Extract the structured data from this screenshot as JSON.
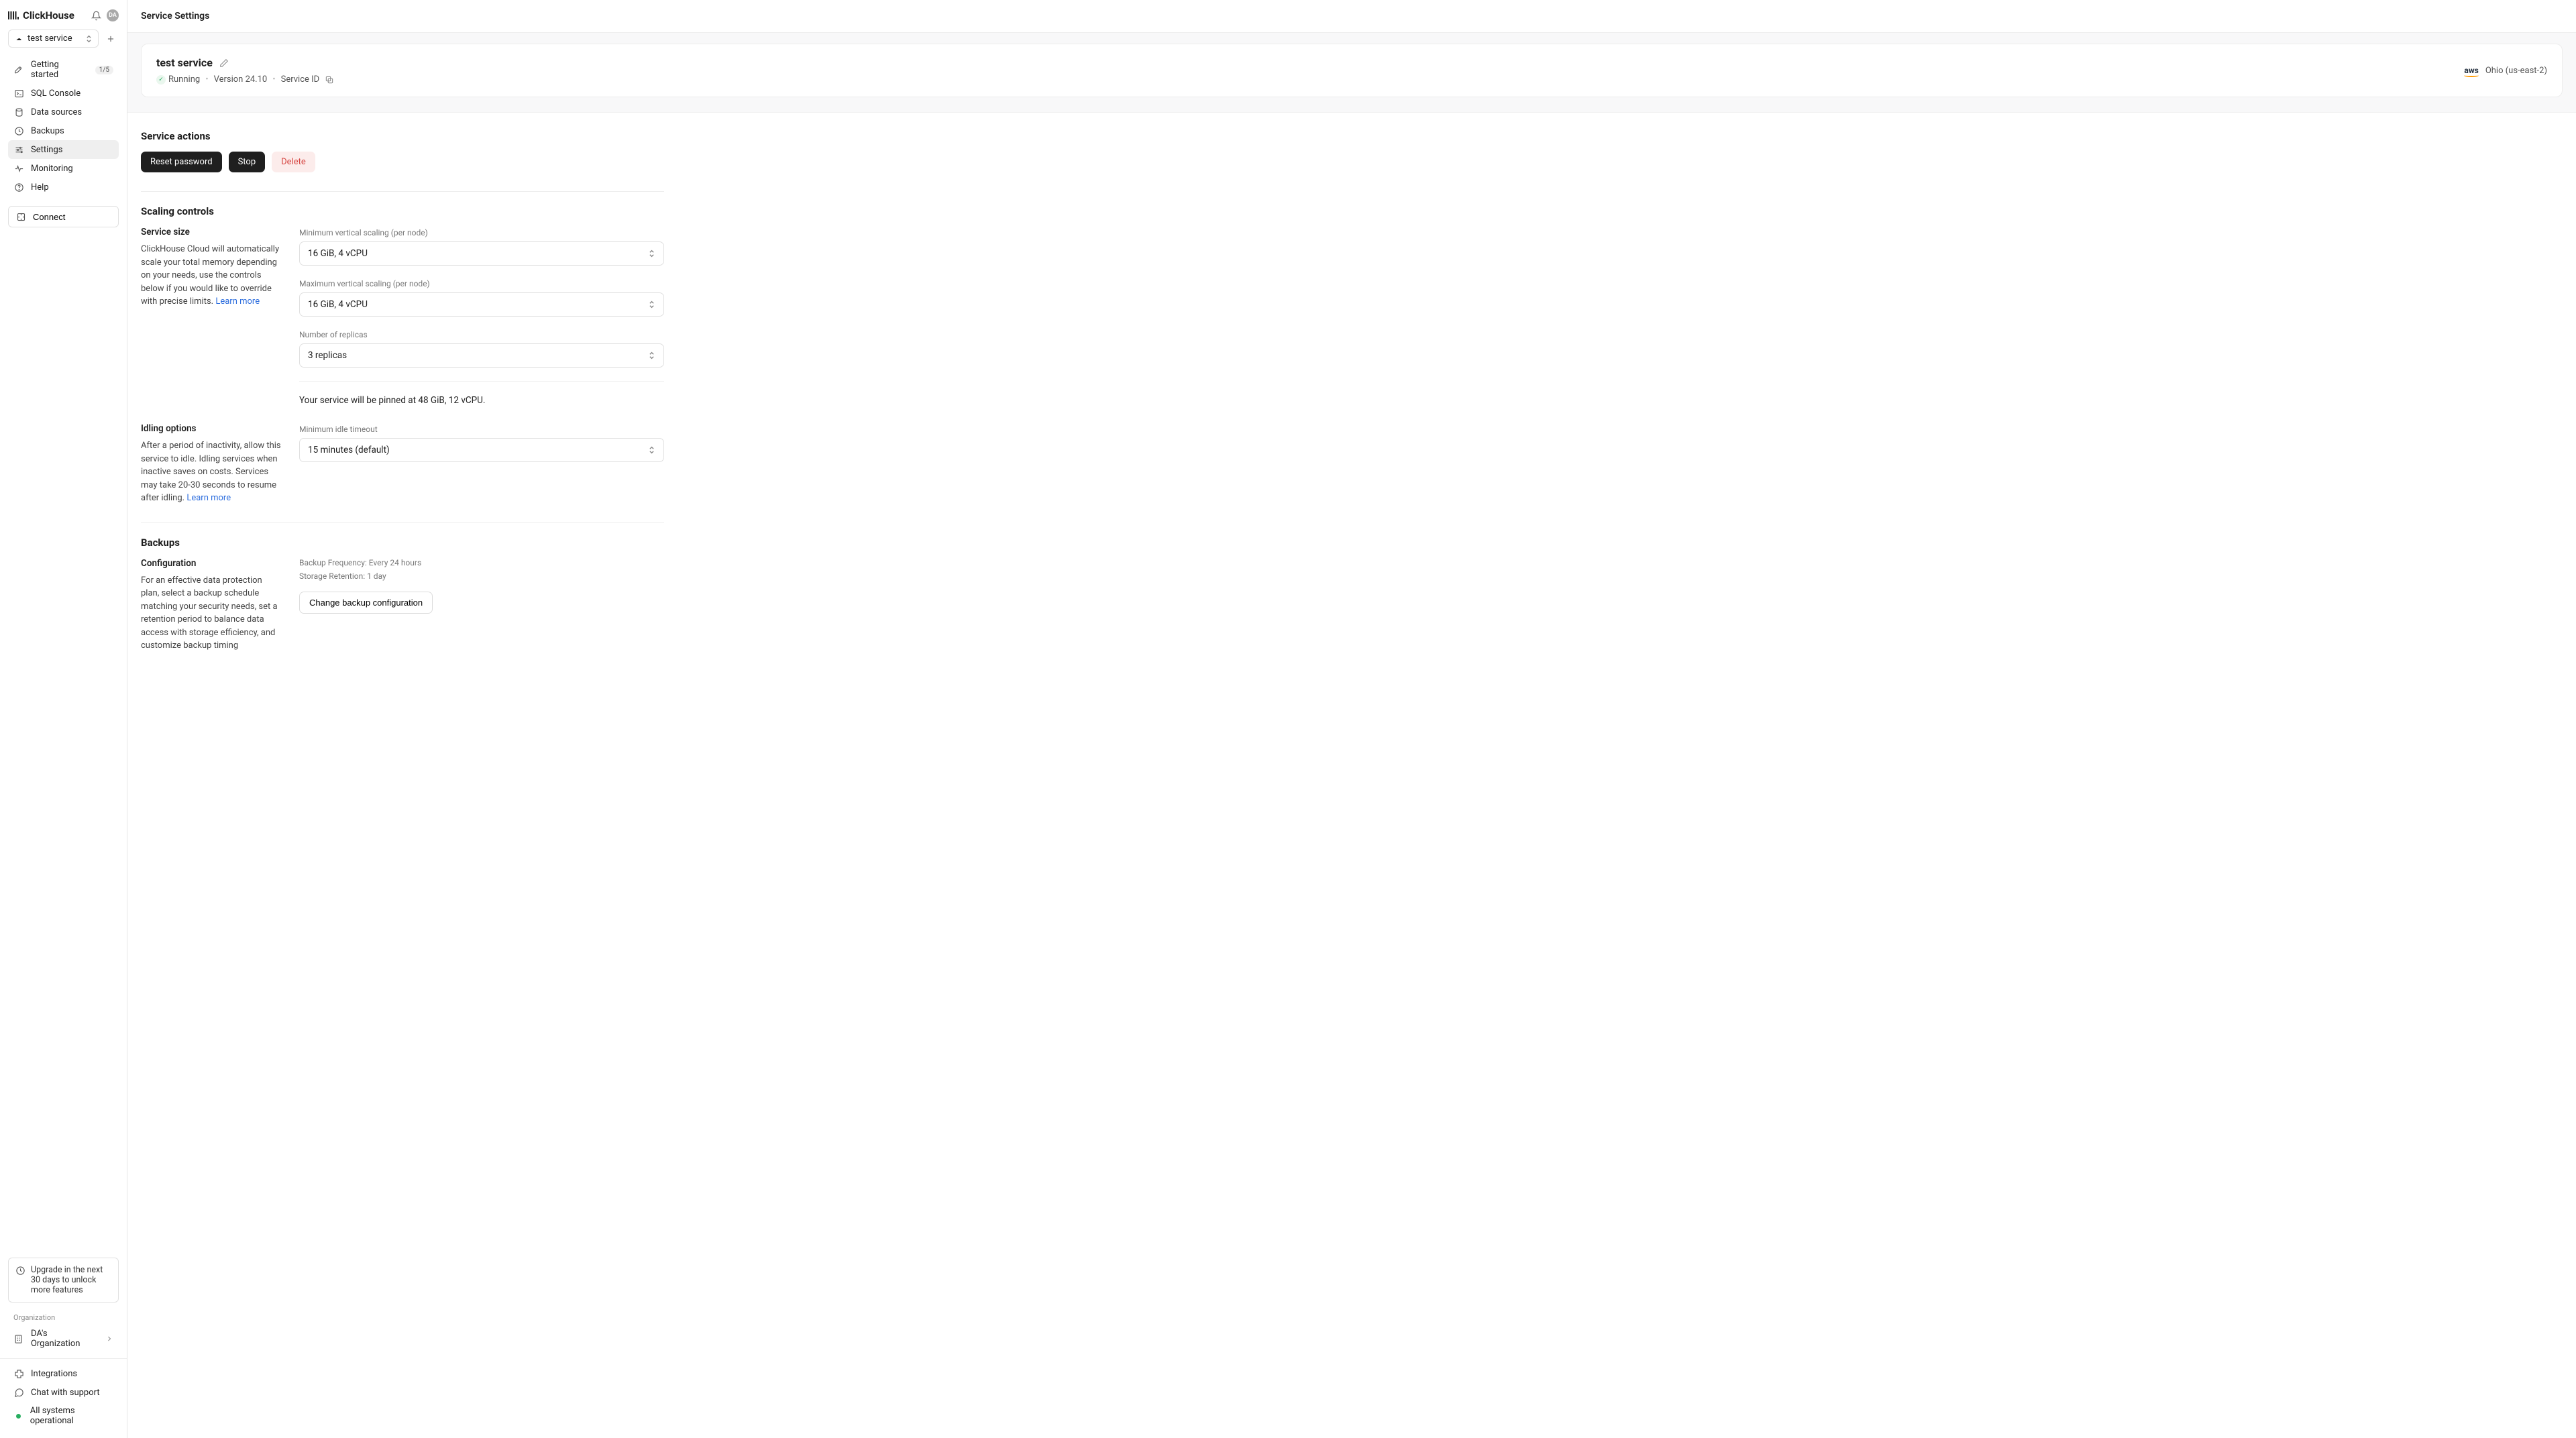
{
  "brand": "ClickHouse",
  "avatar_initials": "DA",
  "service_selector": {
    "label": "test service"
  },
  "nav": {
    "getting_started": "Getting started",
    "getting_started_badge": "1/5",
    "sql_console": "SQL Console",
    "data_sources": "Data sources",
    "backups": "Backups",
    "settings": "Settings",
    "monitoring": "Monitoring",
    "help": "Help",
    "connect": "Connect"
  },
  "upgrade_text": "Upgrade in the next 30 days to unlock more features",
  "org_label": "Organization",
  "org_name": "DA's Organization",
  "footer": {
    "integrations": "Integrations",
    "chat": "Chat with support",
    "status": "All systems operational"
  },
  "page_title": "Service Settings",
  "banner": {
    "service_name": "test service",
    "status": "Running",
    "version": "Version 24.10",
    "service_id_label": "Service ID",
    "provider": "aws",
    "region": "Ohio (us-east-2)"
  },
  "actions": {
    "title": "Service actions",
    "reset": "Reset password",
    "stop": "Stop",
    "delete": "Delete"
  },
  "scaling": {
    "title": "Scaling controls",
    "size_title": "Service size",
    "size_desc": "ClickHouse Cloud will automatically scale your total memory depending on your needs, use the controls below if you would like to override with precise limits. ",
    "learn_more": "Learn more",
    "min_label": "Minimum vertical scaling (per node)",
    "min_value": "16 GiB, 4 vCPU",
    "max_label": "Maximum vertical scaling (per node)",
    "max_value": "16 GiB, 4 vCPU",
    "replicas_label": "Number of replicas",
    "replicas_value": "3 replicas",
    "pinned_note": "Your service will be pinned at 48 GiB, 12 vCPU."
  },
  "idling": {
    "title": "Idling options",
    "desc": "After a period of inactivity, allow this service to idle. Idling services when inactive saves on costs. Services may take 20-30 seconds to resume after idling. ",
    "learn_more": "Learn more",
    "timeout_label": "Minimum idle timeout",
    "timeout_value": "15 minutes (default)"
  },
  "backups": {
    "title": "Backups",
    "config_title": "Configuration",
    "desc": "For an effective data protection plan, select a backup schedule matching your security needs, set a retention period to balance data access with storage efficiency, and customize backup timing",
    "freq": "Backup Frequency: Every 24 hours",
    "retention": "Storage Retention: 1 day",
    "change_btn": "Change backup configuration"
  }
}
